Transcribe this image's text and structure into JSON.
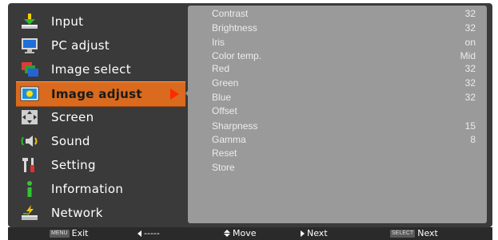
{
  "menu": {
    "items": [
      {
        "label": "Input",
        "icon": "input-download-icon"
      },
      {
        "label": "PC adjust",
        "icon": "monitor-icon"
      },
      {
        "label": "Image select",
        "icon": "image-select-icon"
      },
      {
        "label": "Image adjust",
        "icon": "image-adjust-icon",
        "selected": true
      },
      {
        "label": "Screen",
        "icon": "screen-arrows-icon"
      },
      {
        "label": "Sound",
        "icon": "speaker-icon"
      },
      {
        "label": "Setting",
        "icon": "wrench-icon"
      },
      {
        "label": "Information",
        "icon": "information-icon"
      },
      {
        "label": "Network",
        "icon": "network-icon"
      }
    ]
  },
  "panel": {
    "rows": [
      {
        "name": "Contrast",
        "value": "32"
      },
      {
        "name": "Brightness",
        "value": "32"
      },
      {
        "name": "Iris",
        "value": "on"
      },
      {
        "name": "Color temp.",
        "value": "Mid"
      },
      {
        "name": "Red",
        "value": "32"
      },
      {
        "name": "Green",
        "value": "32"
      },
      {
        "name": "Blue",
        "value": "32"
      },
      {
        "name": "Offset",
        "value": ""
      },
      {
        "name": "Sharpness",
        "value": "15"
      },
      {
        "name": "Gamma",
        "value": "8"
      },
      {
        "name": "Reset",
        "value": ""
      },
      {
        "name": "Store",
        "value": ""
      }
    ]
  },
  "footer": {
    "menu_key": "MENU",
    "exit_label": "Exit",
    "back_label": "-----",
    "move_label": "Move",
    "next_label": "Next",
    "select_key": "SELECT",
    "select_next_label": "Next"
  },
  "colors": {
    "osd_background": "#3a3a3a",
    "panel_background": "#9a9a9a",
    "selected_item": "#d96a1e",
    "selected_arrow": "#ff2a00",
    "footer_background": "#2a2a2a"
  }
}
